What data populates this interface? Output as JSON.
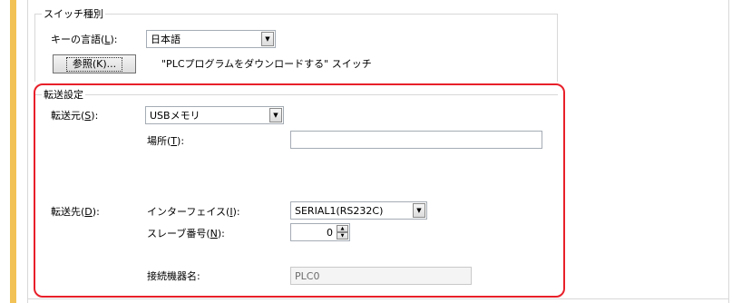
{
  "switch_type": {
    "title": "スイッチ種別",
    "key_language_label": "キーの言語(",
    "key_language_mnemonic": "L",
    "key_language_suffix": "):",
    "key_language_value": "日本語",
    "browse_button": "参照(K)...",
    "switch_name": "\"PLCプログラムをダウンロードする\" スイッチ"
  },
  "transfer": {
    "title": "転送設定",
    "source_label": "転送元(",
    "source_mnemonic": "S",
    "source_suffix": "):",
    "source_value": "USBメモリ",
    "location_label": "場所(",
    "location_mnemonic": "T",
    "location_suffix": "):",
    "location_value": "",
    "dest_label": "転送先(",
    "dest_mnemonic": "D",
    "dest_suffix": "):",
    "interface_label": "インターフェイス(",
    "interface_mnemonic": "I",
    "interface_suffix": "):",
    "interface_value": "SERIAL1(RS232C)",
    "slave_label": "スレーブ番号(",
    "slave_mnemonic": "N",
    "slave_suffix": "):",
    "slave_value": "0",
    "device_name_label": "接続機器名:",
    "device_name_value": "PLC0"
  },
  "colors": {
    "accent_stripe": "#f3c256",
    "highlight_border": "#e8202a"
  },
  "icons": {
    "dropdown": "chevron-down-icon",
    "spin_up": "spin-up-icon",
    "spin_down": "spin-down-icon"
  }
}
